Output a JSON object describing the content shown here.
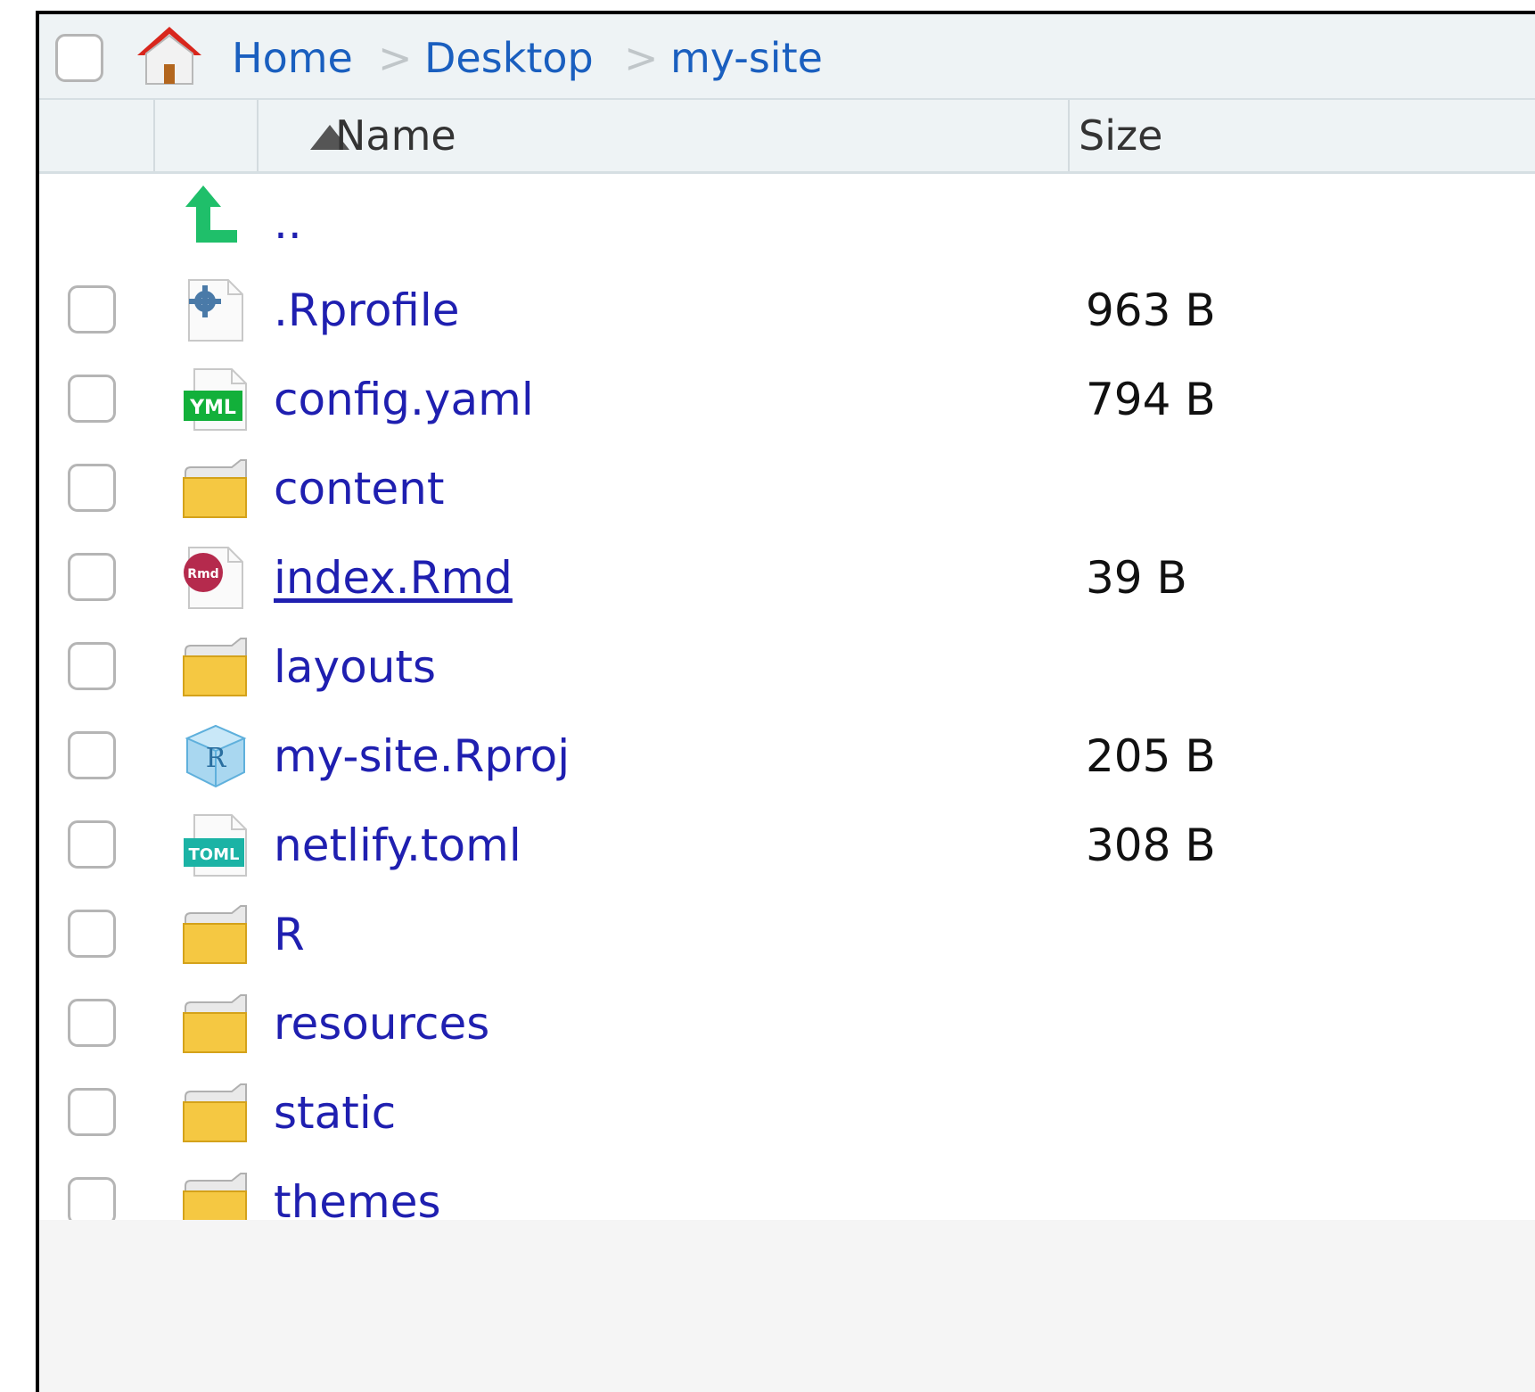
{
  "breadcrumb": {
    "items": [
      "Home",
      "Desktop",
      "my-site"
    ],
    "separator": ">"
  },
  "columns": {
    "name": "Name",
    "size": "Size"
  },
  "parent_link": "..",
  "files": [
    {
      "name": ".Rprofile",
      "size": "963 B",
      "icon": "rprofile-gear-icon"
    },
    {
      "name": "config.yaml",
      "size": "794 B",
      "icon": "yaml-file-icon"
    },
    {
      "name": "content",
      "size": "",
      "icon": "folder-icon"
    },
    {
      "name": "index.Rmd",
      "size": "39 B",
      "icon": "rmd-file-icon"
    },
    {
      "name": "layouts",
      "size": "",
      "icon": "folder-icon"
    },
    {
      "name": "my-site.Rproj",
      "size": "205 B",
      "icon": "rproj-icon"
    },
    {
      "name": "netlify.toml",
      "size": "308 B",
      "icon": "toml-file-icon"
    },
    {
      "name": "R",
      "size": "",
      "icon": "folder-icon"
    },
    {
      "name": "resources",
      "size": "",
      "icon": "folder-icon"
    },
    {
      "name": "static",
      "size": "",
      "icon": "folder-icon"
    },
    {
      "name": "themes",
      "size": "",
      "icon": "folder-icon"
    }
  ],
  "icon_labels": {
    "yaml": "YML",
    "toml": "TOML",
    "rmd": "Rmd",
    "rproj": "R"
  },
  "colors": {
    "link": "#1f1fb0",
    "breadcrumb_link": "#1a5fbf",
    "header_bg": "#eef3f5",
    "folder": "#f2c94c",
    "up_arrow": "#1fbf6a"
  }
}
